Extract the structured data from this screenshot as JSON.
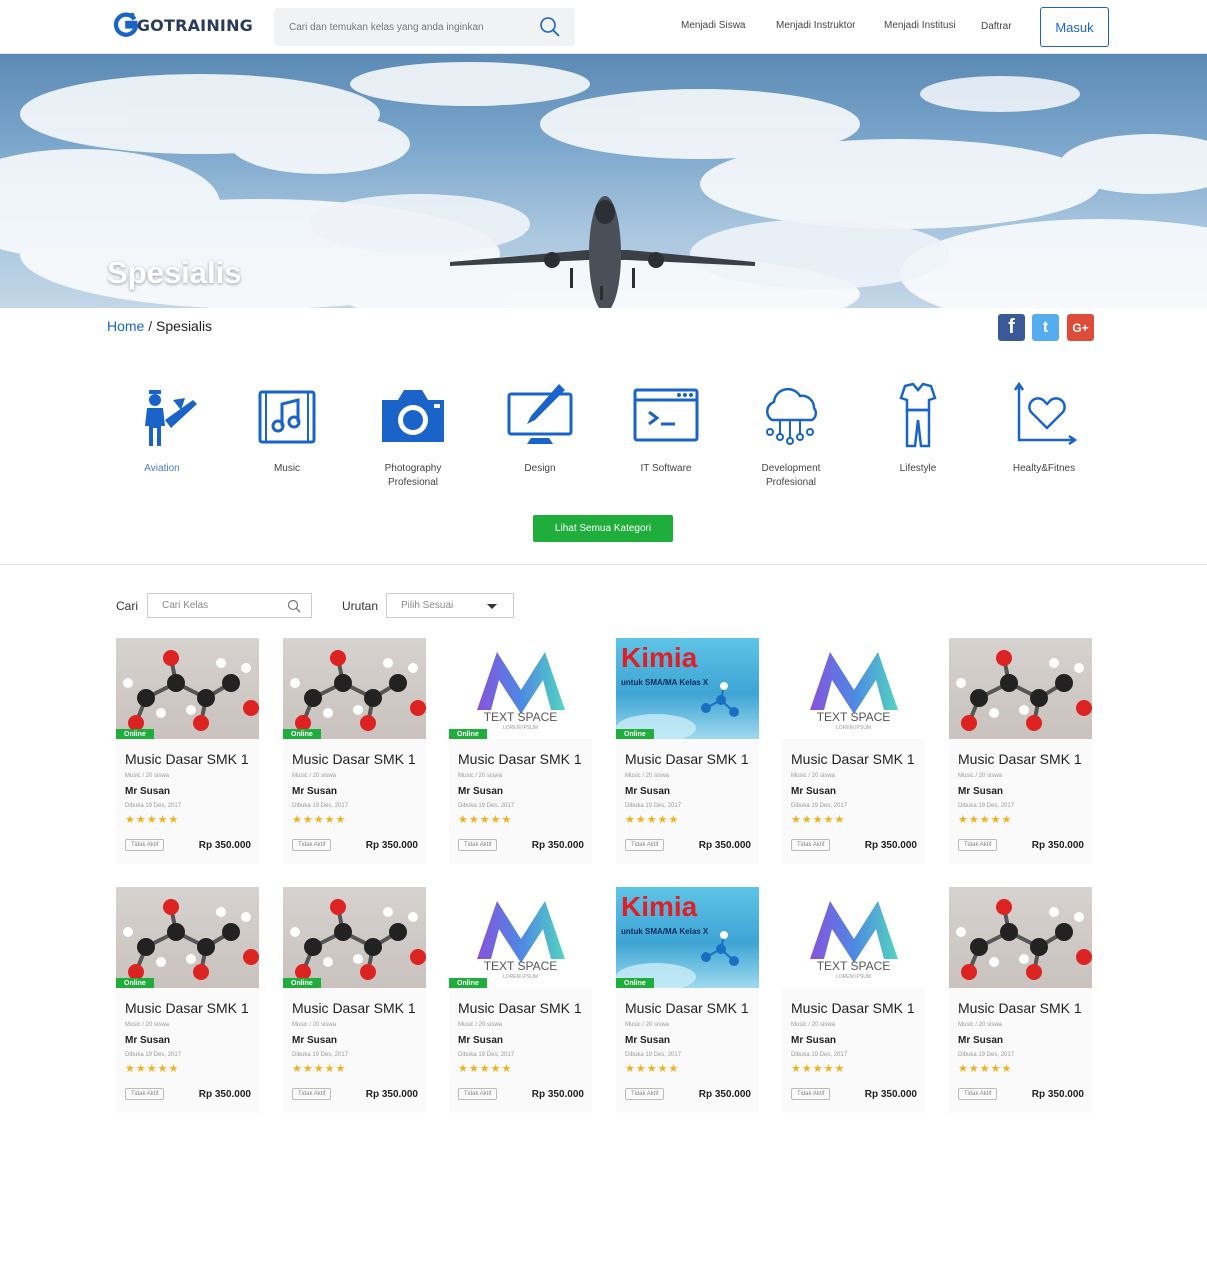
{
  "header": {
    "logo_text": "GOTRAINING",
    "search_placeholder": "Cari dan temukan kelas yang anda inginkan",
    "nav": [
      "Menjadi Siswa",
      "Menjadi Instruktor",
      "Menjadi Institusi",
      "Daftrar"
    ],
    "login_label": "Masuk"
  },
  "hero": {
    "title": "Spesialis"
  },
  "breadcrumb": {
    "home": "Home",
    "separator": " / ",
    "current": "Spesialis"
  },
  "social": [
    {
      "icon": "facebook-icon",
      "glyph": "f",
      "color": "#3b5998"
    },
    {
      "icon": "twitter-icon",
      "glyph": "t",
      "color": "#55acee"
    },
    {
      "icon": "google-plus-icon",
      "glyph": "G+",
      "color": "#dd4b39"
    }
  ],
  "categories": [
    {
      "label": "Aviation",
      "icon": "aviation-icon",
      "active": true
    },
    {
      "label": "Music",
      "icon": "music-icon",
      "active": false
    },
    {
      "label": "Photography\nProfesional",
      "icon": "camera-icon",
      "active": false
    },
    {
      "label": "Design",
      "icon": "design-icon",
      "active": false
    },
    {
      "label": "IT Software",
      "icon": "code-window-icon",
      "active": false
    },
    {
      "label": "Development\nProfesional",
      "icon": "cloud-network-icon",
      "active": false
    },
    {
      "label": "Lifestyle",
      "icon": "clothing-icon",
      "active": false
    },
    {
      "label": "Healty&Fitnes",
      "icon": "heart-chart-icon",
      "active": false
    }
  ],
  "categories_button": "Lihat Semua Kategori",
  "filters": {
    "search_label": "Cari",
    "search_placeholder": "Cari Kelas",
    "sort_label": "Urutan",
    "sort_value": "Pilih Sesuai"
  },
  "colors": {
    "accent": "#1a64c9",
    "green": "#1fae3c",
    "star": "#f2b01e"
  },
  "courses": [
    {
      "thumb": "molecule",
      "badge": "Online",
      "title": "Music Dasar SMK 1",
      "sub": "Music / 20 siswa",
      "author": "Mr Susan",
      "date": "Dibuka 19 Des, 2017",
      "rating": 5,
      "status": "Tidak Aktif",
      "price": "Rp 350.000"
    },
    {
      "thumb": "molecule",
      "badge": "Online",
      "title": "Music Dasar SMK 1",
      "sub": "Music / 20 siswa",
      "author": "Mr Susan",
      "date": "Dibuka 19 Des, 2017",
      "rating": 5,
      "status": "Tidak Aktif",
      "price": "Rp 350.000"
    },
    {
      "thumb": "textspace",
      "badge": "Online",
      "thumb_text": "TEXT SPACE",
      "thumb_sub": "LOREM IPSUM",
      "title": "Music Dasar SMK 1",
      "sub": "Music / 20 siswa",
      "author": "Mr Susan",
      "date": "Dibuka 19 Des, 2017",
      "rating": 5,
      "status": "Tidak Aktif",
      "price": "Rp 350.000"
    },
    {
      "thumb": "kimia",
      "badge": "Online",
      "thumb_text": "Kimia",
      "thumb_sub": "untuk SMA/MA Kelas X",
      "title": "Music Dasar SMK 1",
      "sub": "Music / 20 siswa",
      "author": "Mr Susan",
      "date": "Dibuka 19 Des, 2017",
      "rating": 5,
      "status": "Tidak Aktif",
      "price": "Rp 350.000"
    },
    {
      "thumb": "textspace",
      "badge": "",
      "thumb_text": "TEXT SPACE",
      "thumb_sub": "LOREM IPSUM",
      "title": "Music Dasar SMK 1",
      "sub": "Music / 20 siswa",
      "author": "Mr Susan",
      "date": "Dibuka 19 Des, 2017",
      "rating": 5,
      "status": "Tidak Aktif",
      "price": "Rp 350.000"
    },
    {
      "thumb": "molecule",
      "badge": "",
      "title": "Music Dasar SMK 1",
      "sub": "Music / 20 siswa",
      "author": "Mr Susan",
      "date": "Dibuka 19 Des, 2017",
      "rating": 5,
      "status": "Tidak Aktif",
      "price": "Rp 350.000"
    },
    {
      "thumb": "molecule",
      "badge": "Online",
      "title": "Music Dasar SMK 1",
      "sub": "Music / 20 siswa",
      "author": "Mr Susan",
      "date": "Dibuka 19 Des, 2017",
      "rating": 5,
      "status": "Tidak Aktif",
      "price": "Rp 350.000"
    },
    {
      "thumb": "molecule",
      "badge": "Online",
      "title": "Music Dasar SMK 1",
      "sub": "Music / 20 siswa",
      "author": "Mr Susan",
      "date": "Dibuka 19 Des, 2017",
      "rating": 5,
      "status": "Tidak Aktif",
      "price": "Rp 350.000"
    },
    {
      "thumb": "textspace",
      "badge": "Online",
      "thumb_text": "TEXT SPACE",
      "thumb_sub": "LOREM IPSUM",
      "title": "Music Dasar SMK 1",
      "sub": "Music / 20 siswa",
      "author": "Mr Susan",
      "date": "Dibuka 19 Des, 2017",
      "rating": 5,
      "status": "Tidak Aktif",
      "price": "Rp 350.000"
    },
    {
      "thumb": "kimia",
      "badge": "Online",
      "thumb_text": "Kimia",
      "thumb_sub": "untuk SMA/MA Kelas X",
      "title": "Music Dasar SMK 1",
      "sub": "Music / 20 siswa",
      "author": "Mr Susan",
      "date": "Dibuka 19 Des, 2017",
      "rating": 5,
      "status": "Tidak Aktif",
      "price": "Rp 350.000"
    },
    {
      "thumb": "textspace",
      "badge": "",
      "thumb_text": "TEXT SPACE",
      "thumb_sub": "LOREM IPSUM",
      "title": "Music Dasar SMK 1",
      "sub": "Music / 20 siswa",
      "author": "Mr Susan",
      "date": "Dibuka 19 Des, 2017",
      "rating": 5,
      "status": "Tidak Aktif",
      "price": "Rp 350.000"
    },
    {
      "thumb": "molecule",
      "badge": "",
      "title": "Music Dasar SMK 1",
      "sub": "Music / 20 siswa",
      "author": "Mr Susan",
      "date": "Dibuka 19 Des, 2017",
      "rating": 5,
      "status": "Tidak Aktif",
      "price": "Rp 350.000"
    }
  ]
}
